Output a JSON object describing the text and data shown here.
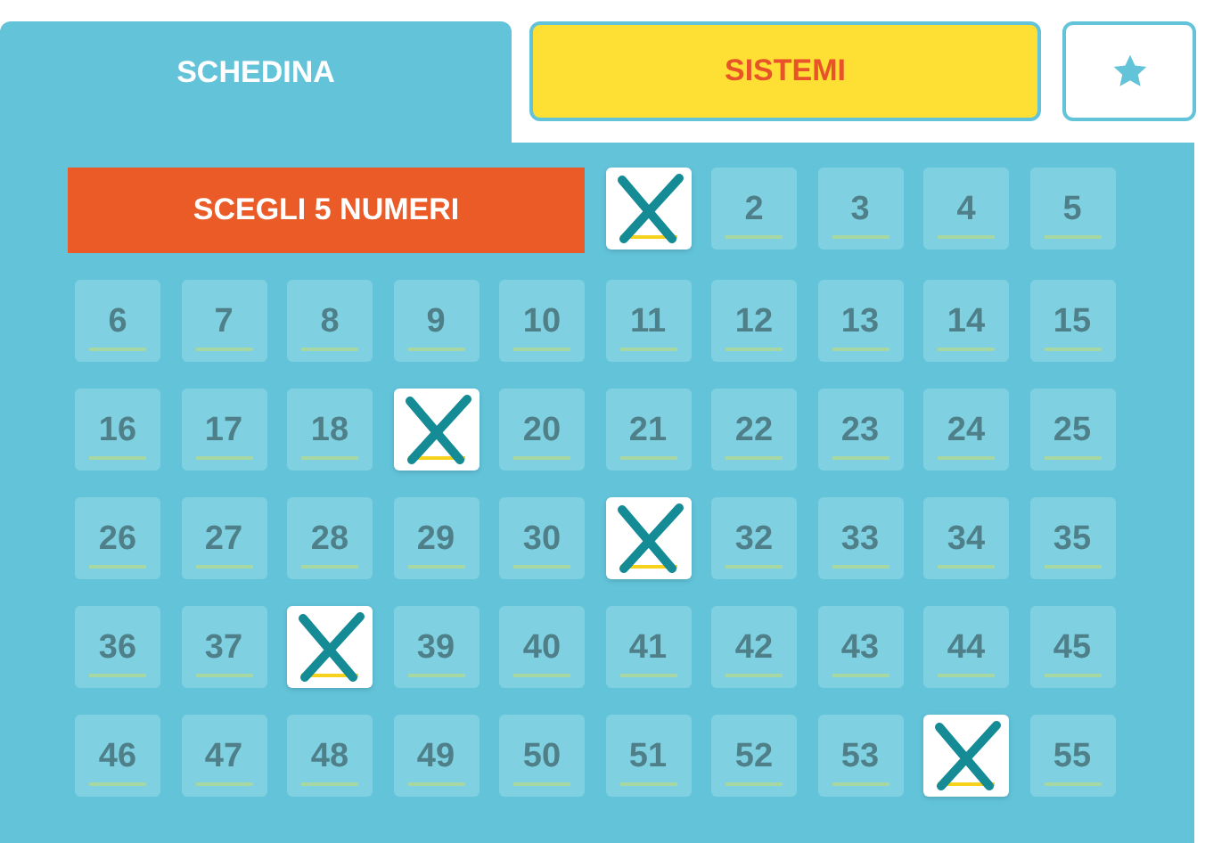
{
  "tabs": [
    {
      "label": "SCHEDINA",
      "selected": true
    },
    {
      "label": "SISTEMI",
      "selected": false
    }
  ],
  "banner": "SCEGLI 5 NUMERI",
  "numbers": [
    {
      "selected": true
    },
    {
      "label": "2",
      "selected": false
    },
    {
      "label": "3",
      "selected": false
    },
    {
      "label": "4",
      "selected": false
    },
    {
      "label": "5",
      "selected": false
    },
    {
      "label": "6",
      "selected": false
    },
    {
      "label": "7",
      "selected": false
    },
    {
      "label": "8",
      "selected": false
    },
    {
      "label": "9",
      "selected": false
    },
    {
      "label": "10",
      "selected": false
    },
    {
      "label": "11",
      "selected": false
    },
    {
      "label": "12",
      "selected": false
    },
    {
      "label": "13",
      "selected": false
    },
    {
      "label": "14",
      "selected": false
    },
    {
      "label": "15",
      "selected": false
    },
    {
      "label": "16",
      "selected": false
    },
    {
      "label": "17",
      "selected": false
    },
    {
      "label": "18",
      "selected": false
    },
    {
      "selected": true
    },
    {
      "label": "20",
      "selected": false
    },
    {
      "label": "21",
      "selected": false
    },
    {
      "label": "22",
      "selected": false
    },
    {
      "label": "23",
      "selected": false
    },
    {
      "label": "24",
      "selected": false
    },
    {
      "label": "25",
      "selected": false
    },
    {
      "label": "26",
      "selected": false
    },
    {
      "label": "27",
      "selected": false
    },
    {
      "label": "28",
      "selected": false
    },
    {
      "label": "29",
      "selected": false
    },
    {
      "label": "30",
      "selected": false
    },
    {
      "selected": true
    },
    {
      "label": "32",
      "selected": false
    },
    {
      "label": "33",
      "selected": false
    },
    {
      "label": "34",
      "selected": false
    },
    {
      "label": "35",
      "selected": false
    },
    {
      "label": "36",
      "selected": false
    },
    {
      "label": "37",
      "selected": false
    },
    {
      "selected": true
    },
    {
      "label": "39",
      "selected": false
    },
    {
      "label": "40",
      "selected": false
    },
    {
      "label": "41",
      "selected": false
    },
    {
      "label": "42",
      "selected": false
    },
    {
      "label": "43",
      "selected": false
    },
    {
      "label": "44",
      "selected": false
    },
    {
      "label": "45",
      "selected": false
    },
    {
      "label": "46",
      "selected": false
    },
    {
      "label": "47",
      "selected": false
    },
    {
      "label": "48",
      "selected": false
    },
    {
      "label": "49",
      "selected": false
    },
    {
      "label": "50",
      "selected": false
    },
    {
      "label": "51",
      "selected": false
    },
    {
      "label": "52",
      "selected": false
    },
    {
      "label": "53",
      "selected": false
    },
    {
      "selected": true
    },
    {
      "label": "55",
      "selected": false
    }
  ]
}
